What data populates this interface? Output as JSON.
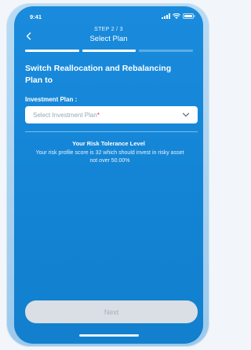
{
  "status_bar": {
    "time": "9:41",
    "icons": [
      "signal-icon",
      "wifi-icon",
      "battery-icon"
    ]
  },
  "header": {
    "back_icon": "chevron-left-icon",
    "step": "STEP 2 / 3",
    "title": "Select Plan"
  },
  "progress": {
    "current_step": 2,
    "total_steps": 3
  },
  "main": {
    "section_title": "Switch Reallocation and Rebalancing Plan to",
    "field_label": "Investment Plan :",
    "select": {
      "placeholder": "Select Investment Plan",
      "required_mark": "*",
      "chevron_icon": "chevron-down-icon"
    },
    "risk": {
      "title": "Your Risk Tolerance Level",
      "text": "Your risk profile score is 32 which should invest in risky asset not over 50.00%"
    }
  },
  "footer": {
    "next_label": "Next"
  },
  "colors": {
    "background": "#1687d8",
    "required": "#e5323b",
    "button_disabled": "#d9dfe5"
  }
}
